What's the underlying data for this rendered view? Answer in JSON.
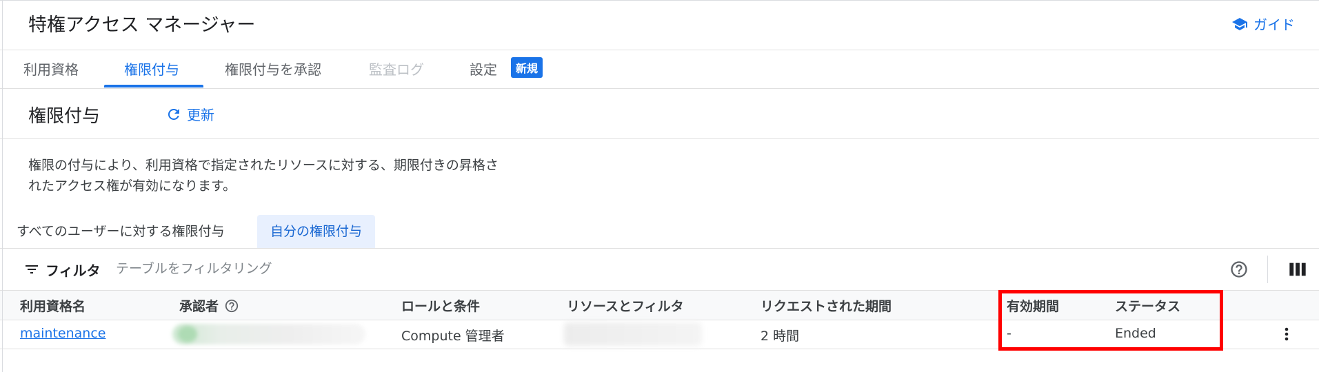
{
  "header": {
    "title": "特権アクセス マネージャー",
    "guide_label": "ガイド",
    "guide_icon": "school-icon"
  },
  "tabs": [
    {
      "label": "利用資格",
      "state": "normal"
    },
    {
      "label": "権限付与",
      "state": "active"
    },
    {
      "label": "権限付与を承認",
      "state": "normal"
    },
    {
      "label": "監査ログ",
      "state": "disabled"
    },
    {
      "label": "設定",
      "state": "normal",
      "badge": "新規"
    }
  ],
  "section": {
    "title": "権限付与",
    "refresh_label": "更新",
    "refresh_icon": "refresh-icon",
    "description_line1": "権限の付与により、利用資格で指定されたリソースに対する、期限付きの昇格さ",
    "description_line2": "れたアクセス権が有効になります。"
  },
  "subtabs": {
    "all": "すべてのユーザーに対する権限付与",
    "mine": "自分の権限付与",
    "selected": "mine"
  },
  "filter": {
    "label": "フィルタ",
    "placeholder": "テーブルをフィルタリング",
    "value": ""
  },
  "table": {
    "columns": [
      "利用資格名",
      "承認者",
      "ロールと条件",
      "リソースとフィルタ",
      "リクエストされた期間",
      "有効期間",
      "ステータス"
    ],
    "rows": [
      {
        "entitlement": "maintenance",
        "approver": "",
        "role": "Compute 管理者",
        "resource": "",
        "duration": "2 時間",
        "validity": "-",
        "status": "Ended"
      }
    ]
  },
  "colors": {
    "accent": "#1a73e8",
    "highlight": "#ff0000",
    "subtab_bg": "#e8f0fe"
  }
}
